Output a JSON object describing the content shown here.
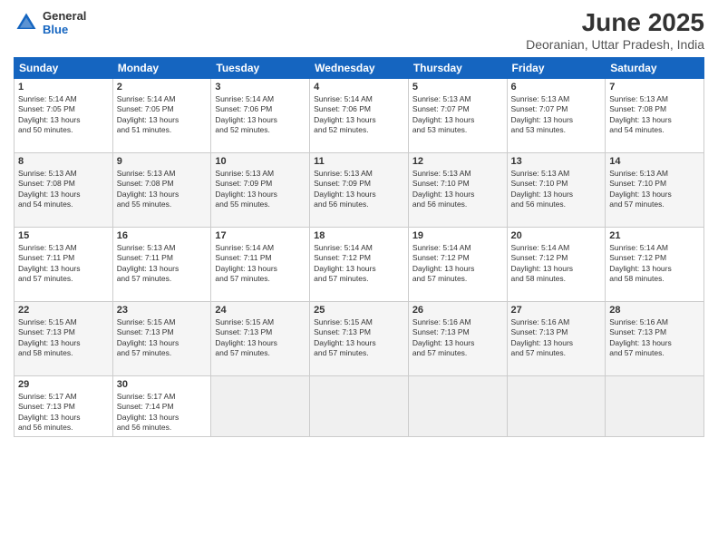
{
  "header": {
    "logo": {
      "general": "General",
      "blue": "Blue"
    },
    "title": "June 2025",
    "subtitle": "Deoranian, Uttar Pradesh, India"
  },
  "days_of_week": [
    "Sunday",
    "Monday",
    "Tuesday",
    "Wednesday",
    "Thursday",
    "Friday",
    "Saturday"
  ],
  "weeks": [
    [
      {
        "day": "1",
        "info": "Sunrise: 5:14 AM\nSunset: 7:05 PM\nDaylight: 13 hours\nand 50 minutes."
      },
      {
        "day": "2",
        "info": "Sunrise: 5:14 AM\nSunset: 7:05 PM\nDaylight: 13 hours\nand 51 minutes."
      },
      {
        "day": "3",
        "info": "Sunrise: 5:14 AM\nSunset: 7:06 PM\nDaylight: 13 hours\nand 52 minutes."
      },
      {
        "day": "4",
        "info": "Sunrise: 5:14 AM\nSunset: 7:06 PM\nDaylight: 13 hours\nand 52 minutes."
      },
      {
        "day": "5",
        "info": "Sunrise: 5:13 AM\nSunset: 7:07 PM\nDaylight: 13 hours\nand 53 minutes."
      },
      {
        "day": "6",
        "info": "Sunrise: 5:13 AM\nSunset: 7:07 PM\nDaylight: 13 hours\nand 53 minutes."
      },
      {
        "day": "7",
        "info": "Sunrise: 5:13 AM\nSunset: 7:08 PM\nDaylight: 13 hours\nand 54 minutes."
      }
    ],
    [
      {
        "day": "8",
        "info": "Sunrise: 5:13 AM\nSunset: 7:08 PM\nDaylight: 13 hours\nand 54 minutes."
      },
      {
        "day": "9",
        "info": "Sunrise: 5:13 AM\nSunset: 7:08 PM\nDaylight: 13 hours\nand 55 minutes."
      },
      {
        "day": "10",
        "info": "Sunrise: 5:13 AM\nSunset: 7:09 PM\nDaylight: 13 hours\nand 55 minutes."
      },
      {
        "day": "11",
        "info": "Sunrise: 5:13 AM\nSunset: 7:09 PM\nDaylight: 13 hours\nand 56 minutes."
      },
      {
        "day": "12",
        "info": "Sunrise: 5:13 AM\nSunset: 7:10 PM\nDaylight: 13 hours\nand 56 minutes."
      },
      {
        "day": "13",
        "info": "Sunrise: 5:13 AM\nSunset: 7:10 PM\nDaylight: 13 hours\nand 56 minutes."
      },
      {
        "day": "14",
        "info": "Sunrise: 5:13 AM\nSunset: 7:10 PM\nDaylight: 13 hours\nand 57 minutes."
      }
    ],
    [
      {
        "day": "15",
        "info": "Sunrise: 5:13 AM\nSunset: 7:11 PM\nDaylight: 13 hours\nand 57 minutes."
      },
      {
        "day": "16",
        "info": "Sunrise: 5:13 AM\nSunset: 7:11 PM\nDaylight: 13 hours\nand 57 minutes."
      },
      {
        "day": "17",
        "info": "Sunrise: 5:14 AM\nSunset: 7:11 PM\nDaylight: 13 hours\nand 57 minutes."
      },
      {
        "day": "18",
        "info": "Sunrise: 5:14 AM\nSunset: 7:12 PM\nDaylight: 13 hours\nand 57 minutes."
      },
      {
        "day": "19",
        "info": "Sunrise: 5:14 AM\nSunset: 7:12 PM\nDaylight: 13 hours\nand 57 minutes."
      },
      {
        "day": "20",
        "info": "Sunrise: 5:14 AM\nSunset: 7:12 PM\nDaylight: 13 hours\nand 58 minutes."
      },
      {
        "day": "21",
        "info": "Sunrise: 5:14 AM\nSunset: 7:12 PM\nDaylight: 13 hours\nand 58 minutes."
      }
    ],
    [
      {
        "day": "22",
        "info": "Sunrise: 5:15 AM\nSunset: 7:13 PM\nDaylight: 13 hours\nand 58 minutes."
      },
      {
        "day": "23",
        "info": "Sunrise: 5:15 AM\nSunset: 7:13 PM\nDaylight: 13 hours\nand 57 minutes."
      },
      {
        "day": "24",
        "info": "Sunrise: 5:15 AM\nSunset: 7:13 PM\nDaylight: 13 hours\nand 57 minutes."
      },
      {
        "day": "25",
        "info": "Sunrise: 5:15 AM\nSunset: 7:13 PM\nDaylight: 13 hours\nand 57 minutes."
      },
      {
        "day": "26",
        "info": "Sunrise: 5:16 AM\nSunset: 7:13 PM\nDaylight: 13 hours\nand 57 minutes."
      },
      {
        "day": "27",
        "info": "Sunrise: 5:16 AM\nSunset: 7:13 PM\nDaylight: 13 hours\nand 57 minutes."
      },
      {
        "day": "28",
        "info": "Sunrise: 5:16 AM\nSunset: 7:13 PM\nDaylight: 13 hours\nand 57 minutes."
      }
    ],
    [
      {
        "day": "29",
        "info": "Sunrise: 5:17 AM\nSunset: 7:13 PM\nDaylight: 13 hours\nand 56 minutes."
      },
      {
        "day": "30",
        "info": "Sunrise: 5:17 AM\nSunset: 7:14 PM\nDaylight: 13 hours\nand 56 minutes."
      },
      {
        "day": "",
        "info": ""
      },
      {
        "day": "",
        "info": ""
      },
      {
        "day": "",
        "info": ""
      },
      {
        "day": "",
        "info": ""
      },
      {
        "day": "",
        "info": ""
      }
    ]
  ]
}
